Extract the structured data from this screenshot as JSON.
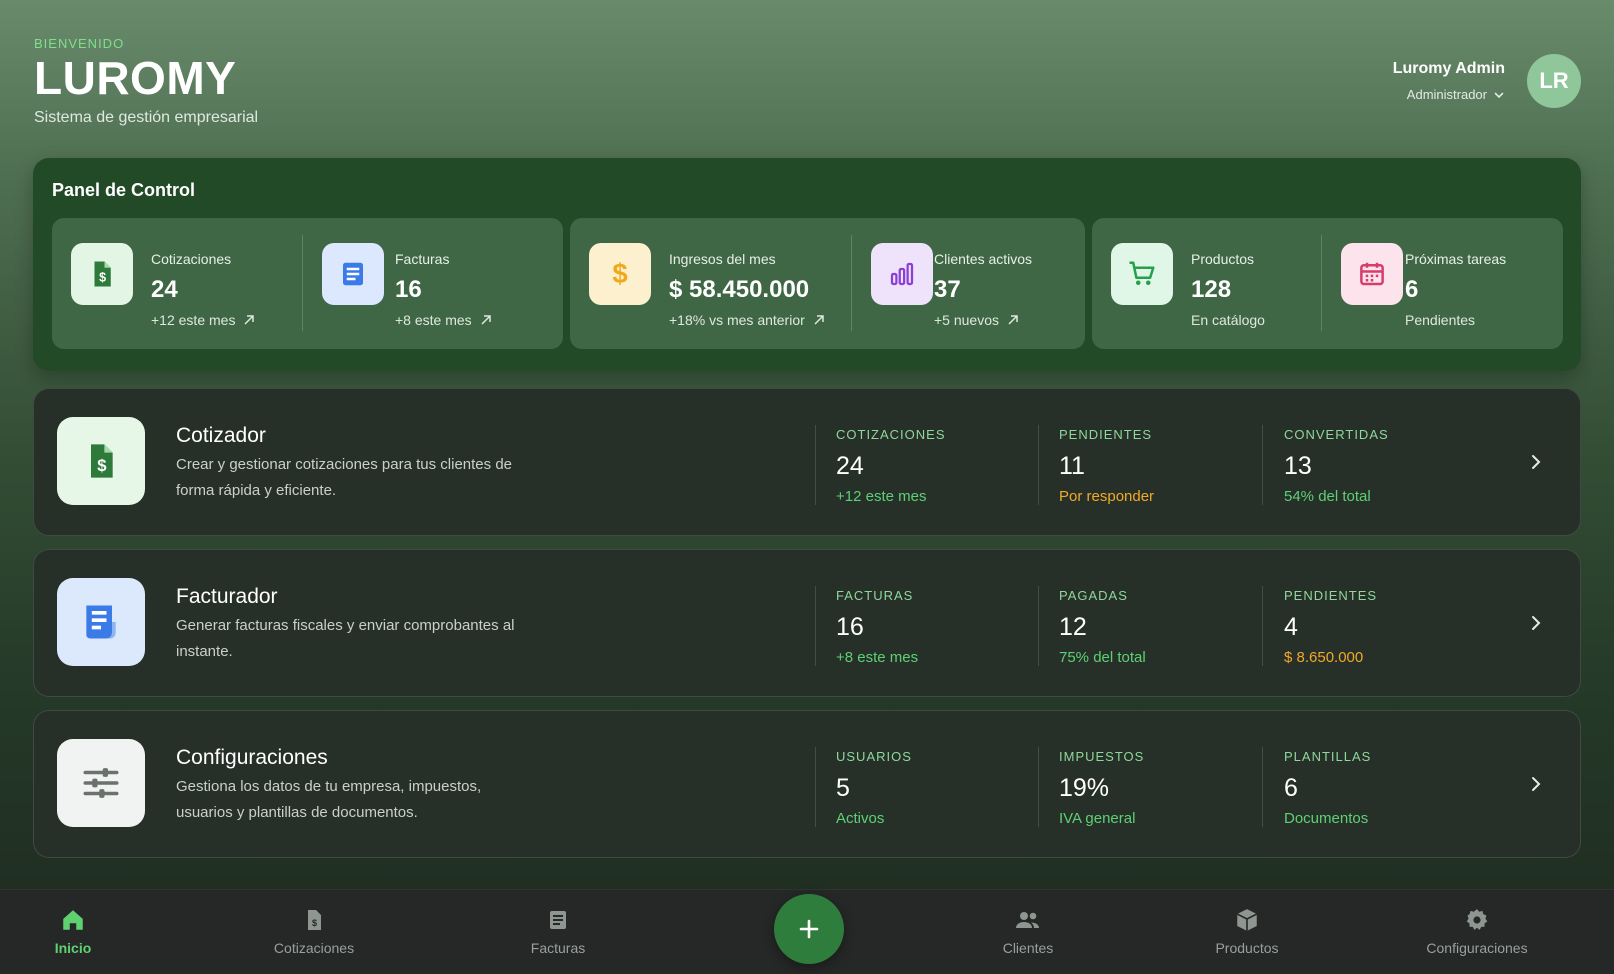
{
  "header": {
    "welcome": "BIENVENIDO",
    "brand": "LUROMY",
    "tagline": "Sistema de gestión empresarial"
  },
  "user": {
    "name": "Luromy Admin",
    "role": "Administrador",
    "initials": "LR"
  },
  "panel": {
    "title": "Panel de Control",
    "stats": [
      {
        "label": "Cotizaciones",
        "value": "24",
        "sub": "+12 este mes",
        "icon": "quote-dollar-icon"
      },
      {
        "label": "Facturas",
        "value": "16",
        "sub": "+8 este mes",
        "icon": "invoice-icon"
      },
      {
        "label": "Ingresos del mes",
        "value": "$ 58.450.000",
        "sub": "+18% vs mes anterior",
        "icon": "dollar-icon"
      },
      {
        "label": "Clientes activos",
        "value": "37",
        "sub": "+5 nuevos",
        "icon": "bar-chart-icon"
      },
      {
        "label": "Productos",
        "value": "128",
        "sub": "En catálogo",
        "icon": "cart-icon"
      },
      {
        "label": "Próximas tareas",
        "value": "6",
        "sub": "Pendientes",
        "icon": "calendar-icon"
      }
    ]
  },
  "modules": [
    {
      "title": "Cotizador",
      "desc": "Crear y gestionar cotizaciones para tus clientes de forma rápida y eficiente.",
      "metrics": [
        {
          "label": "COTIZACIONES",
          "value": "24",
          "sub": "+12 este mes"
        },
        {
          "label": "PENDIENTES",
          "value": "11",
          "sub": "Por responder"
        },
        {
          "label": "CONVERTIDAS",
          "value": "13",
          "sub": "54% del total"
        }
      ]
    },
    {
      "title": "Facturador",
      "desc": "Generar facturas fiscales y enviar comprobantes al instante.",
      "metrics": [
        {
          "label": "FACTURAS",
          "value": "16",
          "sub": "+8 este mes"
        },
        {
          "label": "PAGADAS",
          "value": "12",
          "sub": "75% del total"
        },
        {
          "label": "PENDIENTES",
          "value": "4",
          "sub": "$ 8.650.000"
        }
      ]
    },
    {
      "title": "Configuraciones",
      "desc": "Gestiona los datos de tu empresa, impuestos, usuarios y plantillas de documentos.",
      "metrics": [
        {
          "label": "USUARIOS",
          "value": "5",
          "sub": "Activos"
        },
        {
          "label": "IMPUESTOS",
          "value": "19%",
          "sub": "IVA general"
        },
        {
          "label": "PLANTILLAS",
          "value": "6",
          "sub": "Documentos"
        }
      ]
    }
  ],
  "nav": {
    "items": [
      {
        "label": "Inicio",
        "icon": "home-icon",
        "active": true
      },
      {
        "label": "Cotizaciones",
        "icon": "quote-icon"
      },
      {
        "label": "Facturas",
        "icon": "invoice-icon"
      },
      {
        "label": "Clientes",
        "icon": "people-icon"
      },
      {
        "label": "Productos",
        "icon": "box-icon"
      },
      {
        "label": "Configuraciones",
        "icon": "gear-icon"
      }
    ],
    "fab_icon": "plus-icon"
  },
  "colors": {
    "accent_green": "#5ed074",
    "warning_orange": "#f1a92b",
    "panel_bg": "#234a27",
    "card_bg": "#263029",
    "fab": "#2f7d3c"
  }
}
